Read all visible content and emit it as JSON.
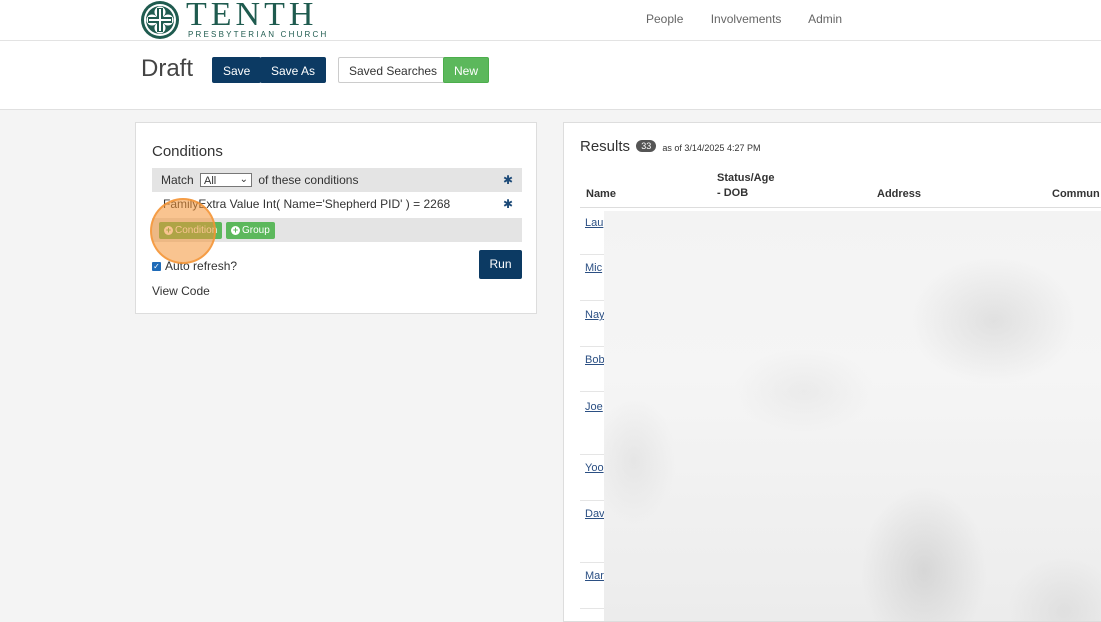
{
  "brand": {
    "name": "TENTH",
    "subtitle": "PRESBYTERIAN CHURCH",
    "color": "#1f5b4f"
  },
  "nav": {
    "items": [
      "People",
      "Involvements",
      "Admin"
    ]
  },
  "header": {
    "title": "Draft",
    "save_label": "Save",
    "save_as_label": "Save As",
    "saved_searches_label": "Saved Searches",
    "new_label": "New"
  },
  "conditions": {
    "title": "Conditions",
    "match_prefix": "Match",
    "match_value": "All",
    "match_suffix": "of these conditions",
    "condition_text": "FamilyExtra Value Int( Name='Shepherd PID' ) = 2268",
    "add_condition_label": "Condition",
    "add_group_label": "Group",
    "auto_refresh_label": "Auto refresh?",
    "auto_refresh_checked": true,
    "run_label": "Run",
    "view_code_label": "View Code"
  },
  "results": {
    "title": "Results",
    "count": "33",
    "as_of": "as of 3/14/2025 4:27 PM",
    "columns": {
      "name": "Name",
      "status_line1": "Status/Age",
      "status_line2": "- DOB",
      "address": "Address",
      "community": "Commun"
    },
    "rows": [
      "Lau",
      "Mic",
      "Nay",
      "Bob",
      "Joe",
      "Yoo",
      "Dav",
      "Mar"
    ]
  },
  "colors": {
    "navy": "#0c3a63",
    "green": "#5cb85c",
    "highlight": "#f49434"
  }
}
